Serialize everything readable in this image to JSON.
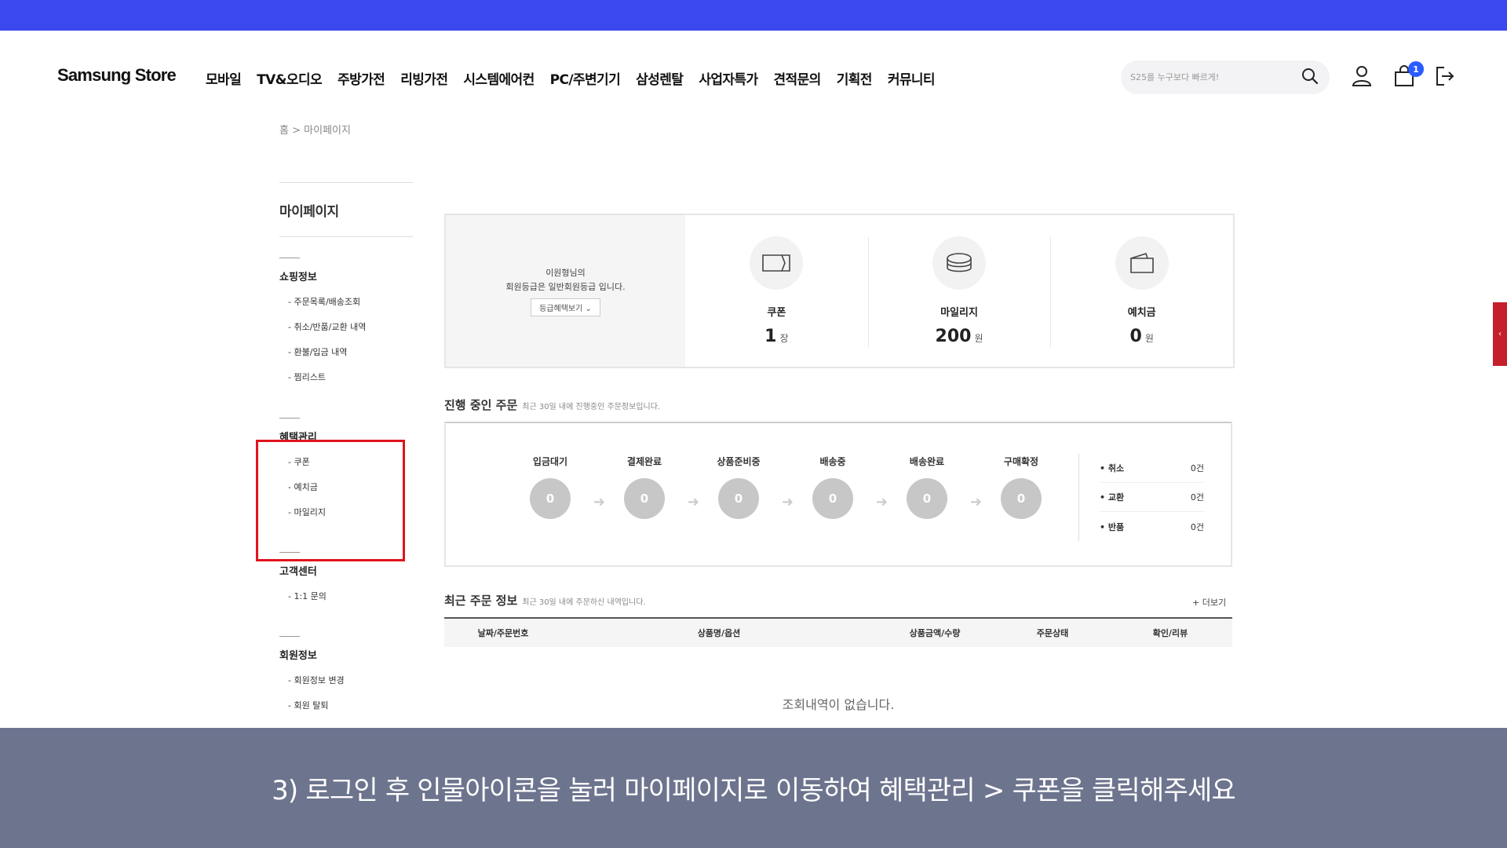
{
  "header": {
    "logo": "Samsung Store",
    "nav": [
      "모바일",
      "TV&오디오",
      "주방가전",
      "리빙가전",
      "시스템에어컨",
      "PC/주변기기",
      "삼성렌탈",
      "사업자특가",
      "견적문의",
      "기획전",
      "커뮤니티"
    ],
    "search_placeholder": "S25를 누구보다 빠르게!",
    "cart_count": "1"
  },
  "breadcrumb": "홈 > 마이페이지",
  "sidebar": {
    "title": "마이페이지",
    "groups": [
      {
        "title": "쇼핑정보",
        "items": [
          "- 주문목록/배송조회",
          "- 취소/반품/교환 내역",
          "- 환불/입금 내역",
          "- 찜리스트"
        ]
      },
      {
        "title": "혜택관리",
        "items": [
          "- 쿠폰",
          "- 예치금",
          "- 마일리지"
        ]
      },
      {
        "title": "고객센터",
        "items": [
          "- 1:1 문의"
        ]
      },
      {
        "title": "회원정보",
        "items": [
          "- 회원정보 변경",
          "- 회원 탈퇴"
        ]
      }
    ]
  },
  "summary": {
    "grade_line1": "이원형님의",
    "grade_line2": "회원등급은 일반회원등급 입니다.",
    "grade_button": "등급혜택보기 ⌄",
    "stats": [
      {
        "label": "쿠폰",
        "value": "1",
        "unit": "장",
        "icon": "coupon-icon"
      },
      {
        "label": "마일리지",
        "value": "200",
        "unit": "원",
        "icon": "mileage-icon"
      },
      {
        "label": "예치금",
        "value": "0",
        "unit": "원",
        "icon": "wallet-icon"
      }
    ]
  },
  "orders_progress": {
    "title": "진행 중인 주문",
    "subtitle": "최근 30일 내에 진행중인 주문정보입니다.",
    "steps": [
      {
        "label": "입금대기",
        "count": "0"
      },
      {
        "label": "결제완료",
        "count": "0"
      },
      {
        "label": "상품준비중",
        "count": "0"
      },
      {
        "label": "배송중",
        "count": "0"
      },
      {
        "label": "배송완료",
        "count": "0"
      },
      {
        "label": "구매확정",
        "count": "0"
      }
    ],
    "side": [
      {
        "name": "• 취소",
        "count": "0건"
      },
      {
        "name": "• 교환",
        "count": "0건"
      },
      {
        "name": "• 반품",
        "count": "0건"
      }
    ]
  },
  "recent_orders": {
    "title": "최근 주문 정보",
    "subtitle": "최근 30일 내에 주문하신 내역입니다.",
    "more": "+ 더보기",
    "columns": [
      "날짜/주문번호",
      "상품명/옵션",
      "상품금액/수량",
      "주문상태",
      "확인/리뷰"
    ],
    "empty": "조회내역이 없습니다."
  },
  "side_tab": "‹",
  "caption": "3) 로그인 후 인물아이콘을 눌러 마이페이지로 이동하여 혜택관리 > 쿠폰을 클릭해주세요",
  "colors": {
    "top_bar": "#3b48ee",
    "highlight": "#e0141e",
    "caption_bg": "#6d748e"
  }
}
